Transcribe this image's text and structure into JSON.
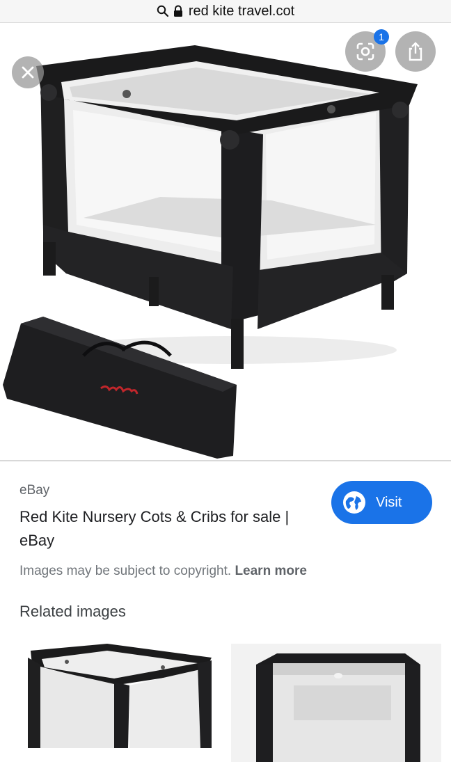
{
  "urlbar": {
    "query": "red kite travel.cot"
  },
  "viewer": {
    "lens_badge_count": "1"
  },
  "result": {
    "source": "eBay",
    "title": "Red Kite Nursery Cots & Cribs for sale | eBay",
    "visit_label": "Visit",
    "copyright_text": "Images may be subject to copyright.",
    "learn_more": "Learn more",
    "related_heading": "Related images"
  },
  "colors": {
    "accent": "#1a73e8",
    "brand_label": "#c0262b"
  }
}
